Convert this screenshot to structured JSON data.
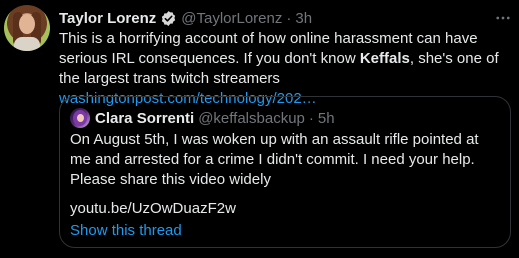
{
  "tweet": {
    "author_name": "Taylor Lorenz",
    "handle": "@TaylorLorenz",
    "separator": "·",
    "time": "3h",
    "body_prefix": "This is a horrifying account of how online harassment can have serious IRL consequences. If you don't know ",
    "body_bold": "Keffals",
    "body_suffix": ", she's one of the largest trans twitch streamers ",
    "body_link": "washingtonpost.com/technology/202…"
  },
  "quote": {
    "author_name": "Clara Sorrenti",
    "handle": "@keffalsbackup",
    "separator": "·",
    "time": "5h",
    "body": "On August 5th, I was woken up with an assault rifle pointed at me and arrested for a crime I didn't commit. I need your help. Please share this video widely",
    "link": "youtu.be/UzOwDuazF2w",
    "show_thread": "Show this thread"
  },
  "colors": {
    "background": "#000000",
    "text": "#e7e9ea",
    "secondary": "#71767b",
    "link": "#1d9bf0",
    "border": "#2f3336"
  },
  "icons": {
    "verified": "verified-badge-icon",
    "more": "more-options-icon"
  }
}
